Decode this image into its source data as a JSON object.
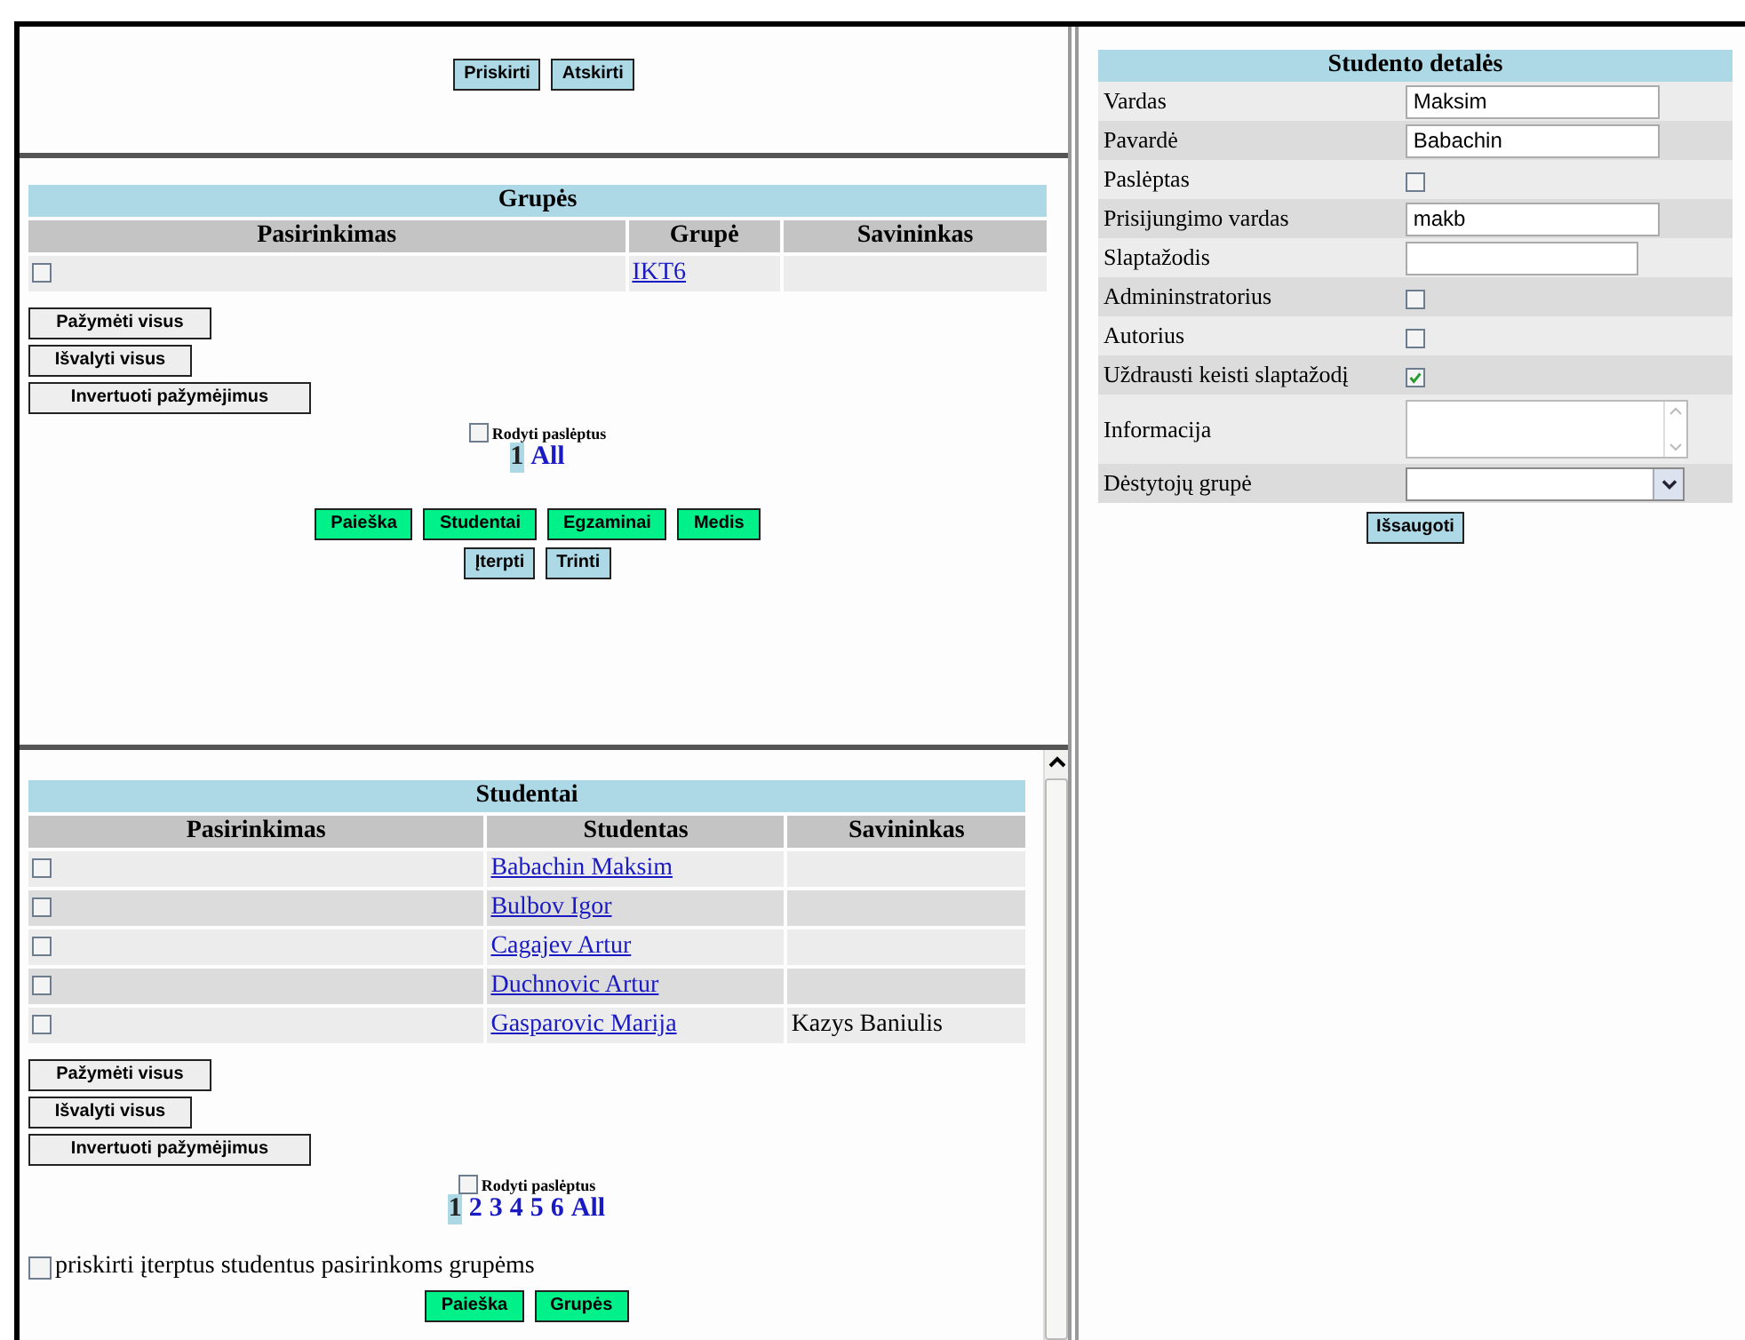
{
  "assign_frame": {
    "buttons": [
      "Priskirti",
      "Atskirti"
    ]
  },
  "groups": {
    "title": "Grupės",
    "columns": [
      "Pasirinkimas",
      "Grupė",
      "Savininkas"
    ],
    "rows": [
      {
        "checked": false,
        "name": "IKT6"
      }
    ],
    "select_buttons": [
      "Pažymėti visus",
      "Išvalyti visus",
      "Invertuoti pažymėjimus"
    ],
    "show_hidden": {
      "label": "Rodyti paslėptus",
      "checked": false
    },
    "pages": [
      {
        "label": "1",
        "selected": true
      },
      {
        "label": "All",
        "selected": false
      }
    ],
    "nav_buttons": [
      "Paieška",
      "Studentai",
      "Egzaminai",
      "Medis"
    ],
    "action_buttons": [
      "Įterpti",
      "Trinti"
    ]
  },
  "students": {
    "title": "Studentai",
    "columns": [
      "Pasirinkimas",
      "Studentas",
      "Savininkas"
    ],
    "rows": [
      {
        "checked": false,
        "name": "Babachin Maksim"
      },
      {
        "checked": false,
        "name": "Bulbov Igor"
      },
      {
        "checked": false,
        "name": "Cagajev Artur"
      },
      {
        "checked": false,
        "name": "Duchnovic Artur"
      },
      {
        "checked": false,
        "name": "Gasparovic Marija",
        "owner": "Kazys Baniulis"
      }
    ],
    "select_buttons": [
      "Pažymėti visus",
      "Išvalyti visus",
      "Invertuoti pažymėjimus"
    ],
    "show_hidden": {
      "label": "Rodyti paslėptus",
      "checked": false
    },
    "pages": [
      {
        "label": "1",
        "selected": true
      },
      {
        "label": "2",
        "selected": false
      },
      {
        "label": "3",
        "selected": false
      },
      {
        "label": "4",
        "selected": false
      },
      {
        "label": "5",
        "selected": false
      },
      {
        "label": "6",
        "selected": false
      },
      {
        "label": "All",
        "selected": false
      }
    ],
    "assign_option": {
      "label": "priskirti įterptus studentus pasirinkoms grupėms",
      "checked": false
    },
    "nav_buttons": [
      "Paieška",
      "Grupės"
    ]
  },
  "details": {
    "title": "Studento detalės",
    "fields": [
      {
        "kind": "text",
        "label": "Vardas",
        "value": "Maksim"
      },
      {
        "kind": "text",
        "label": "Pavardė",
        "value": "Babachin"
      },
      {
        "kind": "checkbox",
        "label": "Paslėptas",
        "checked": false
      },
      {
        "kind": "text",
        "label": "Prisijungimo vardas",
        "value": "makb"
      },
      {
        "kind": "password",
        "label": "Slaptažodis"
      },
      {
        "kind": "checkbox",
        "label": "Admininstratorius",
        "checked": false
      },
      {
        "kind": "checkbox",
        "label": "Autorius",
        "checked": false
      },
      {
        "kind": "checkbox",
        "label": "Uždrausti keisti slaptažodį",
        "checked": true
      },
      {
        "kind": "textarea",
        "label": "Informacija"
      },
      {
        "kind": "select",
        "label": "Dėstytojų grupė"
      }
    ],
    "save_button": "Išsaugoti"
  }
}
